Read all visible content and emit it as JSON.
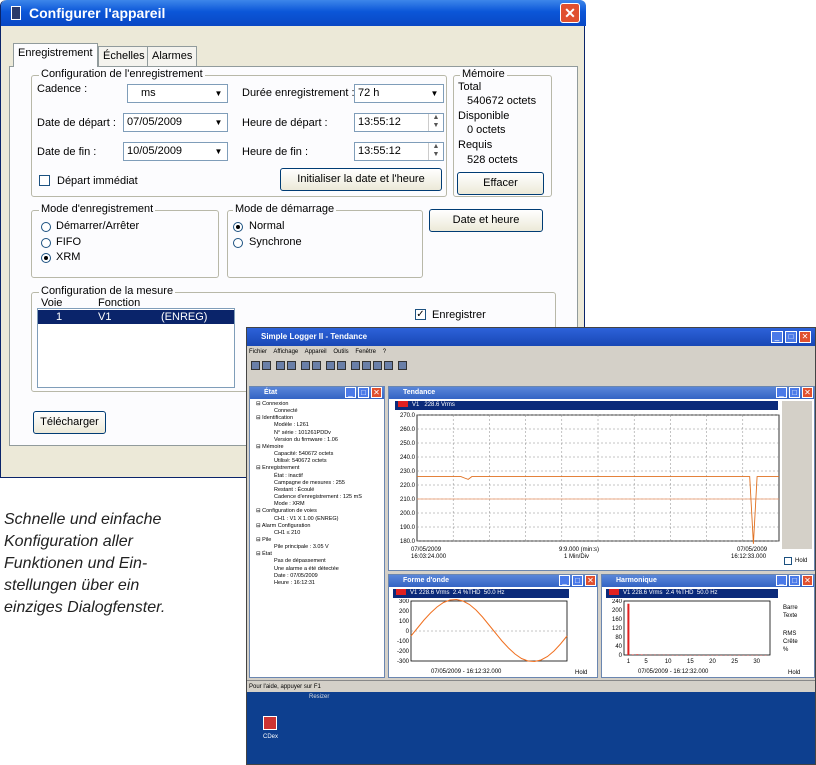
{
  "dialog": {
    "title": "Configurer l'appareil",
    "tabs": [
      "Enregistrement",
      "Échelles",
      "Alarmes"
    ],
    "config_group": "Configuration de l'enregistrement",
    "cadence_label": "Cadence :",
    "cadence_value": "ms",
    "duree_label": "Durée enregistrement :",
    "duree_value": "72 h",
    "date_depart_label": "Date de départ :",
    "date_depart_value": "07/05/2009",
    "heure_depart_label": "Heure de départ :",
    "heure_depart_value": "13:55:12",
    "date_fin_label": "Date de fin :",
    "date_fin_value": "10/05/2009",
    "heure_fin_label": "Heure de fin :",
    "heure_fin_value": "13:55:12",
    "depart_immediat": "Départ immédiat",
    "init_button": "Initialiser la date et l'heure",
    "memoire": {
      "title": "Mémoire",
      "total_label": "Total",
      "total_value": "540672 octets",
      "disponible_label": "Disponible",
      "disponible_value": "0 octets",
      "requis_label": "Requis",
      "requis_value": "528 octets",
      "effacer": "Effacer"
    },
    "mode_enr": {
      "title": "Mode d'enregistrement",
      "options": [
        "Démarrer/Arrêter",
        "FIFO",
        "XRM"
      ]
    },
    "mode_dem": {
      "title": "Mode de démarrage",
      "options": [
        "Normal",
        "Synchrone"
      ]
    },
    "date_heure_button": "Date et heure",
    "mesure": {
      "title": "Configuration de la mesure",
      "col_voie": "Voie",
      "col_fonction": "Fonction",
      "row_voie": "1",
      "row_canal": "V1",
      "row_fonction": "(ENREG)",
      "enregistrer": "Enregistrer"
    },
    "telecharger": "Télécharger",
    "select_color": "#0a246a"
  },
  "caption": [
    "Schnelle und einfache",
    "Konfiguration aller",
    "Funktionen und Ein-",
    "stellungen über ein",
    "einziges Dialogfenster."
  ],
  "logger": {
    "title": "Simple Logger II - Tendance",
    "menu": [
      "Fichier",
      "Affichage",
      "Appareil",
      "Outils",
      "Fenêtre",
      "?"
    ],
    "etat": {
      "title": "État",
      "lines": [
        "Connexion",
        "Connecté",
        "Identification",
        "Modèle : L261",
        "N° série : 101261PDDv",
        "Version du firmware : 1.06",
        "Mémoire",
        "Capacité: 540672 octets",
        "Utilisé: 540672 octets",
        "Enregistrement",
        "État : inactif",
        "Campagne de mesures : 255",
        "Restant : Écoulé",
        "Cadence d'enregistrement : 125 mS",
        "Mode : XRM",
        "Configuration de voies",
        "CH1 : V1 X 1.00 (ENREG)",
        "Alarm Configuration",
        "CH1 ≤ 210",
        "Pile",
        "Pile principale : 3.05 V",
        "État",
        "Pas de dépassement",
        "Une alarme a été détectée",
        "Date : 07/05/2009",
        "Heure : 16:12:31"
      ]
    },
    "tendance": {
      "title": "Tendance",
      "channel": "V1",
      "value": "228.6 Vrms",
      "start_date": "07/05/2009",
      "start_time": "16:03:24.000",
      "mid1": "9:9.000 (min:s)",
      "mid2": "1 Min/Div",
      "end_date": "07/05/2009",
      "end_time": "16:12:33.000",
      "hold": "Hold"
    },
    "forme": {
      "title": "Forme d'onde",
      "channel": "V1",
      "value": "228.6 Vrms",
      "thd": "2.4 %THD",
      "freq": "50.0 Hz",
      "footer": "07/05/2009 - 16:12:32.000",
      "hold": "Hold"
    },
    "harm": {
      "title": "Harmonique",
      "channel": "V1",
      "value": "228.6 Vrms",
      "thd": "2.4 %THD",
      "freq": "50.0 Hz",
      "footer": "07/05/2009 - 16:12:32.000",
      "opts1": [
        "Barre",
        "Texte"
      ],
      "opts2": [
        "RMS",
        "Crête",
        "%"
      ],
      "hold": "Hold"
    },
    "status": "Pour l'aide, appuyer sur F1",
    "desktop_icon": "CDex",
    "taskbar_item": "Resizer"
  },
  "chart_data": [
    {
      "type": "line",
      "title": "Tendance",
      "ylim": [
        180,
        270
      ],
      "yticks": [
        270,
        260,
        250,
        240,
        230,
        220,
        210,
        200,
        190,
        180
      ],
      "series": [
        {
          "name": "V1",
          "values": [
            226,
            226,
            226,
            226,
            226,
            226,
            226,
            226,
            226,
            226,
            226,
            226,
            226,
            225,
            224,
            226,
            226,
            226,
            226,
            226,
            226,
            226,
            226,
            226,
            226,
            226,
            226,
            226,
            226,
            226,
            226,
            226,
            226,
            226,
            226,
            226,
            226,
            226,
            226,
            226,
            226,
            226,
            226,
            226,
            226,
            226,
            226,
            226,
            226,
            226,
            226,
            226,
            226,
            226,
            226,
            226,
            226,
            226,
            226,
            226,
            226,
            226,
            226,
            226,
            226,
            226,
            226,
            226,
            226,
            226,
            226,
            226,
            226,
            226,
            226,
            226,
            226,
            226,
            226,
            226,
            226,
            226,
            226,
            226,
            226,
            226,
            226,
            226,
            226,
            226,
            226,
            226,
            178,
            226,
            226,
            226,
            226,
            226,
            226,
            226
          ]
        }
      ],
      "threshold": 210
    },
    {
      "type": "line",
      "title": "Forme d'onde",
      "ylim": [
        -300,
        300
      ],
      "yticks": [
        300,
        200,
        100,
        0,
        -100,
        -200,
        -300
      ],
      "series": [
        {
          "name": "V1",
          "values": [
            -50,
            30,
            110,
            180,
            240,
            285,
            310,
            315,
            300,
            265,
            210,
            140,
            60,
            -20,
            -100,
            -170,
            -230,
            -275,
            -300,
            -305,
            -290,
            -255,
            -200,
            -130,
            -50
          ]
        }
      ]
    },
    {
      "type": "bar",
      "title": "Harmonique",
      "ylim": [
        0,
        240
      ],
      "yticks": [
        240,
        200,
        160,
        120,
        80,
        40,
        0
      ],
      "xticks": [
        1,
        5,
        10,
        15,
        20,
        25,
        30
      ],
      "values": [
        228,
        2,
        3,
        2,
        1,
        1,
        1,
        1,
        1,
        1,
        0,
        0,
        0,
        0,
        0,
        0,
        0,
        0,
        0,
        0,
        0,
        0,
        0,
        0,
        0,
        0,
        0,
        0,
        0,
        0,
        0,
        0
      ]
    }
  ]
}
